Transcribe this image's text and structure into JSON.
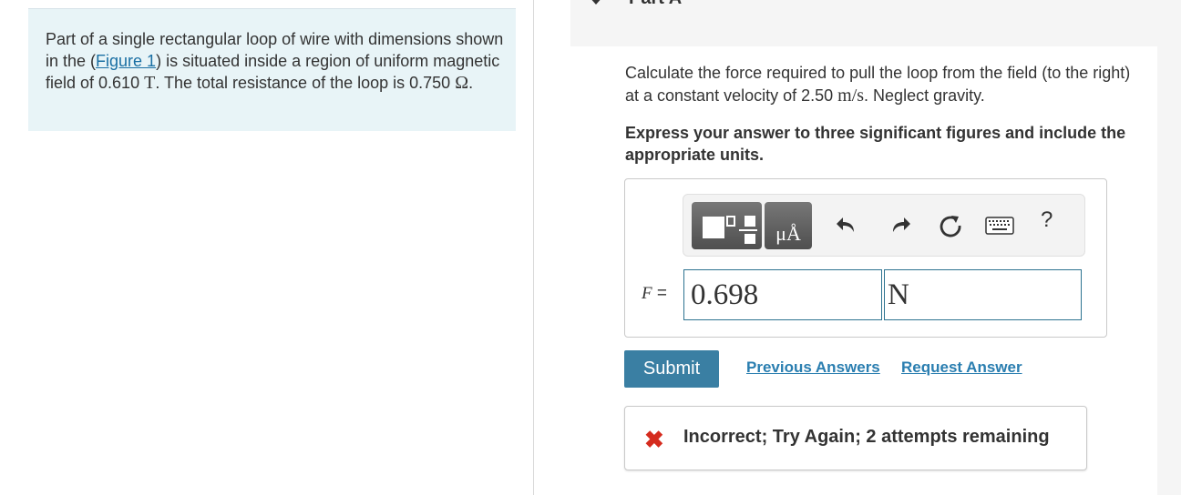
{
  "problem": {
    "text_before_link": "Part of a single rectangular loop of wire with dimensions shown in the (",
    "figure_link": "Figure 1",
    "text_after_link": ") is situated inside a region of uniform magnetic field of 0.610 ",
    "field_unit": "T",
    "text_resistance": ". The total resistance of the loop is 0.750 ",
    "resistance_unit": "Ω",
    "text_end": "."
  },
  "part": {
    "title": "Part A"
  },
  "question": {
    "text": "Calculate the force required to pull the loop from the field (to the right) at a constant velocity of 2.50 ",
    "unit": "m/s",
    "text_end": ". Neglect gravity."
  },
  "instruction": "Express your answer to three significant figures and include the appropriate units.",
  "toolbar": {
    "template_icon": "fraction-template-icon",
    "units_label": "μÅ",
    "undo_icon": "undo-icon",
    "redo_icon": "redo-icon",
    "reset_icon": "reset-icon",
    "keyboard_icon": "keyboard-icon",
    "help_label": "?"
  },
  "answer": {
    "variable": "F",
    "equals": "=",
    "value": "0.698",
    "unit": "N"
  },
  "actions": {
    "submit": "Submit",
    "previous_answers": "Previous Answers",
    "request_answer": "Request Answer"
  },
  "feedback": {
    "icon": "incorrect-x-icon",
    "message": "Incorrect; Try Again; 2 attempts remaining"
  },
  "colors": {
    "panel_bg": "#e8f4f7",
    "accent": "#3a7fa3",
    "link": "#2a7eb0",
    "error": "#d52b1e"
  }
}
